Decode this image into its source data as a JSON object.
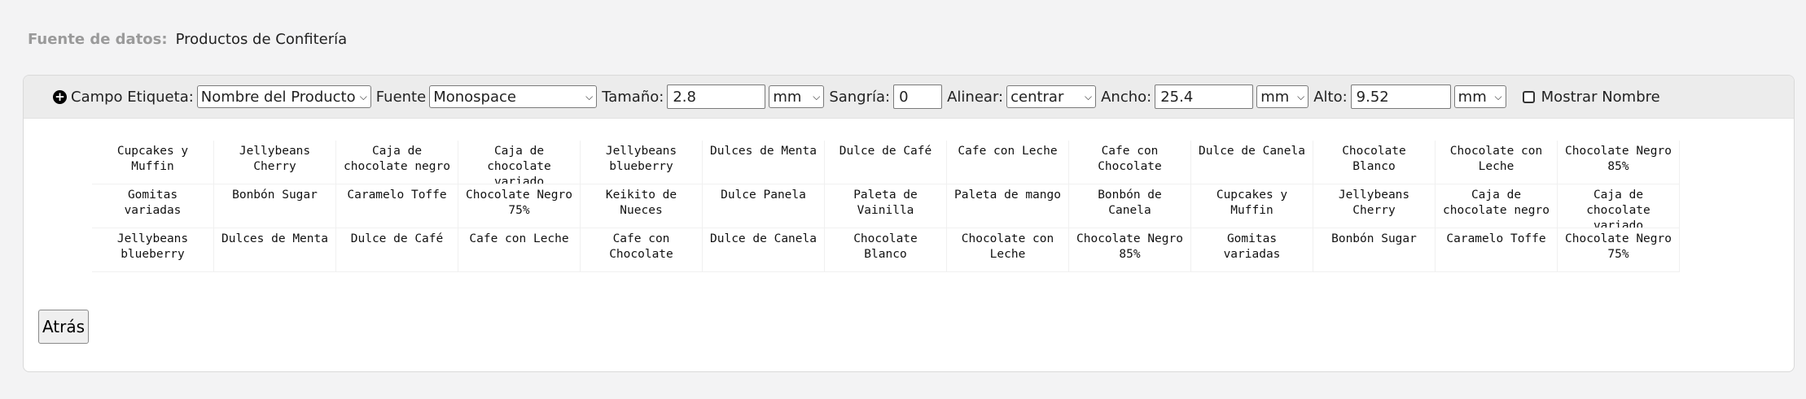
{
  "source": {
    "label": "Fuente de datos:",
    "value": "Productos de Confitería"
  },
  "toolbar": {
    "campo_label": "Campo Etiqueta:",
    "campo_value": "Nombre del Producto",
    "fuente_label": "Fuente",
    "fuente_value": "Monospace",
    "tamano_label": "Tamaño:",
    "tamano_value": "2.8",
    "tamano_unit": "mm",
    "sangria_label": "Sangría:",
    "sangria_value": "0",
    "alinear_label": "Alinear:",
    "alinear_value": "centrar",
    "ancho_label": "Ancho:",
    "ancho_value": "25.4",
    "ancho_unit": "mm",
    "alto_label": "Alto:",
    "alto_value": "9.52",
    "alto_unit": "mm",
    "mostrar_label": "Mostrar Nombre",
    "mostrar_checked": false
  },
  "labels": [
    "Cupcakes y Muffin",
    "Jellybeans Cherry",
    "Caja de chocolate negro",
    "Caja de chocolate variado",
    "Jellybeans blueberry",
    "Dulces de Menta",
    "Dulce de Café",
    "Cafe con Leche",
    "Cafe con Chocolate",
    "Dulce de Canela",
    "Chocolate Blanco",
    "Chocolate con Leche",
    "Chocolate Negro 85%",
    "Gomitas variadas",
    "Bonbón Sugar",
    "Caramelo Toffe",
    "Chocolate Negro 75%",
    "Keikito de Nueces",
    "Dulce Panela",
    "Paleta de Vainilla",
    "Paleta de mango",
    "Bonbón de Canela",
    "Cupcakes y Muffin",
    "Jellybeans Cherry",
    "Caja de chocolate negro",
    "Caja de chocolate variado",
    "Jellybeans blueberry",
    "Dulces de Menta",
    "Dulce de Café",
    "Cafe con Leche",
    "Cafe con Chocolate",
    "Dulce de Canela",
    "Chocolate Blanco",
    "Chocolate con Leche",
    "Chocolate Negro 85%",
    "Gomitas variadas",
    "Bonbón Sugar",
    "Caramelo Toffe",
    "Chocolate Negro 75%"
  ],
  "back_button": "Atrás"
}
